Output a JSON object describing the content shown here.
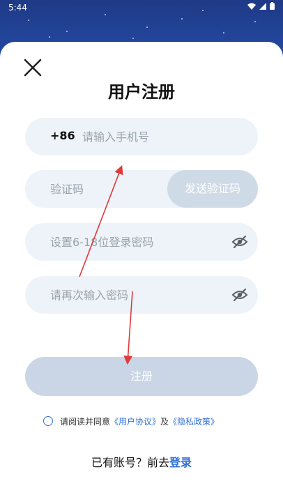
{
  "status": {
    "time": "5:44"
  },
  "sheet": {
    "title": "用户注册"
  },
  "phone": {
    "prefix": "+86",
    "placeholder": "请输入手机号"
  },
  "code": {
    "placeholder": "验证码",
    "send_label": "发送验证码"
  },
  "password": {
    "placeholder": "设置6-18位登录密码"
  },
  "confirm": {
    "placeholder": "请再次输入密码"
  },
  "register": {
    "label": "注册"
  },
  "agreement": {
    "prefix": "请阅读并同意",
    "user_agreement": "《用户协议》",
    "and": "及",
    "privacy_policy": "《隐私政策》"
  },
  "login": {
    "prompt": "已有账号？前去",
    "link": "登录"
  },
  "colors": {
    "accent": "#2f6fd6",
    "field_bg": "#edf3f8",
    "button_disabled": "#cad6e6",
    "annotation": "#e03a3a"
  },
  "icons": [
    "close-icon",
    "eye-off-icon",
    "wifi-icon",
    "signal-icon",
    "battery-icon"
  ]
}
